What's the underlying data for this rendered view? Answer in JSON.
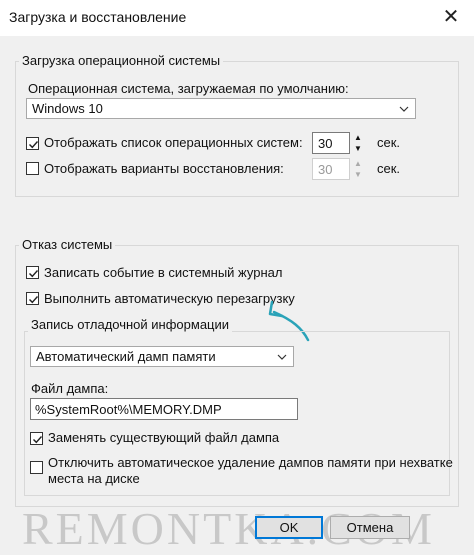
{
  "window": {
    "title": "Загрузка и восстановление",
    "close_glyph": "✕"
  },
  "os_group": {
    "title": "Загрузка операционной системы",
    "default_os_label": "Операционная система, загружаемая по умолчанию:",
    "default_os_value": "Windows 10",
    "show_os_list": {
      "label": "Отображать список операционных систем:",
      "checked": true,
      "value": "30",
      "unit": "сек."
    },
    "show_recovery": {
      "label": "Отображать варианты восстановления:",
      "checked": false,
      "value": "30",
      "unit": "сек."
    }
  },
  "failure_group": {
    "title": "Отказ системы",
    "write_event": {
      "label": "Записать событие в системный журнал",
      "checked": true
    },
    "auto_restart": {
      "label": "Выполнить автоматическую перезагрузку",
      "checked": true
    },
    "debug": {
      "title": "Запись отладочной информации",
      "dump_type": "Автоматический дамп памяти",
      "dump_file_label": "Файл дампа:",
      "dump_file_value": "%SystemRoot%\\MEMORY.DMP",
      "overwrite": {
        "label": "Заменять существующий файл дампа",
        "checked": true
      },
      "disable_auto_delete": {
        "label_line1": "Отключить автоматическое удаление дампов памяти при нехватке",
        "label_line2": "места на диске",
        "checked": false
      }
    }
  },
  "buttons": {
    "ok": "OK",
    "cancel": "Отмена"
  },
  "watermark": "REMONTKA.COM",
  "colors": {
    "accent": "#0078d7",
    "annotation_arrow": "#2aa3b8"
  }
}
